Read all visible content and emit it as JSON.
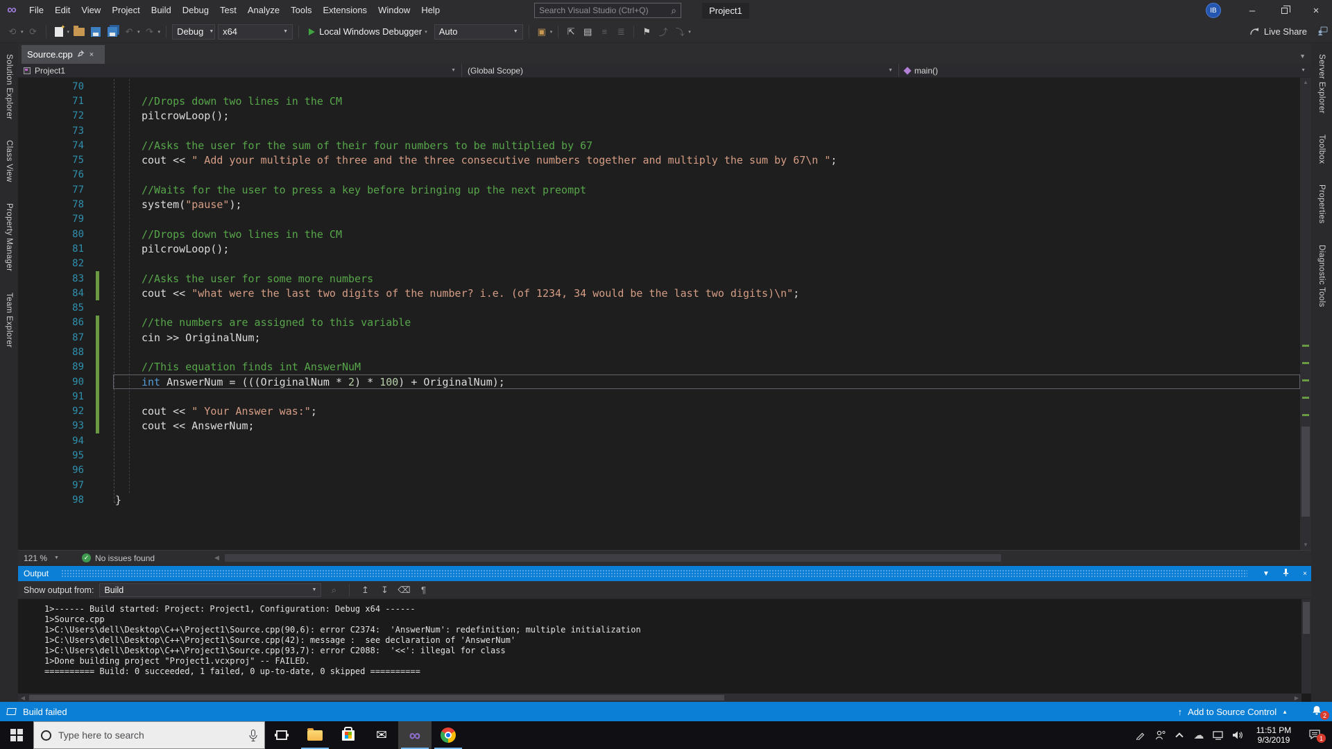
{
  "window": {
    "project": "Project1",
    "search_placeholder": "Search Visual Studio (Ctrl+Q)",
    "user_initials": "IB",
    "live_share": "Live Share"
  },
  "menu": {
    "items": [
      "File",
      "Edit",
      "View",
      "Project",
      "Build",
      "Debug",
      "Test",
      "Analyze",
      "Tools",
      "Extensions",
      "Window",
      "Help"
    ]
  },
  "toolbar": {
    "configuration": "Debug",
    "platform": "x64",
    "debugger": "Local Windows Debugger",
    "attach": "Auto"
  },
  "panels": {
    "left": [
      "Solution Explorer",
      "Class View",
      "Property Manager",
      "Team Explorer"
    ],
    "right": [
      "Server Explorer",
      "Toolbox",
      "Properties",
      "Diagnostic Tools"
    ]
  },
  "editor": {
    "tab": "Source.cpp",
    "breadcrumb": {
      "project": "Project1",
      "scope": "(Global Scope)",
      "method": "main()"
    },
    "zoom_level": "121 %",
    "health": "No issues found",
    "lines": [
      {
        "n": 70,
        "ind": 1,
        "segs": []
      },
      {
        "n": 71,
        "ind": 1,
        "segs": [
          {
            "c": "cm",
            "t": "//Drops down two lines in the CM"
          }
        ]
      },
      {
        "n": 72,
        "ind": 1,
        "segs": [
          {
            "c": "pl",
            "t": "pilcrowLoop();"
          }
        ]
      },
      {
        "n": 73,
        "ind": 1,
        "segs": []
      },
      {
        "n": 74,
        "ind": 1,
        "segs": [
          {
            "c": "cm",
            "t": "//Asks the user for the sum of their four numbers to be multiplied by 67"
          }
        ]
      },
      {
        "n": 75,
        "ind": 1,
        "segs": [
          {
            "c": "pl",
            "t": "cout << "
          },
          {
            "c": "st",
            "t": "\" Add your multiple of three and the three consecutive numbers together and multiply the sum by 67\\n \""
          },
          {
            "c": "pl",
            "t": ";"
          }
        ]
      },
      {
        "n": 76,
        "ind": 1,
        "segs": []
      },
      {
        "n": 77,
        "ind": 1,
        "segs": [
          {
            "c": "cm",
            "t": "//Waits for the user to press a key before bringing up the next preompt"
          }
        ]
      },
      {
        "n": 78,
        "ind": 1,
        "segs": [
          {
            "c": "pl",
            "t": "system("
          },
          {
            "c": "st",
            "t": "\"pause\""
          },
          {
            "c": "pl",
            "t": ");"
          }
        ]
      },
      {
        "n": 79,
        "ind": 1,
        "segs": []
      },
      {
        "n": 80,
        "ind": 1,
        "segs": [
          {
            "c": "cm",
            "t": "//Drops down two lines in the CM"
          }
        ]
      },
      {
        "n": 81,
        "ind": 1,
        "segs": [
          {
            "c": "pl",
            "t": "pilcrowLoop();"
          }
        ]
      },
      {
        "n": 82,
        "ind": 1,
        "segs": []
      },
      {
        "n": 83,
        "ind": 1,
        "chg": true,
        "segs": [
          {
            "c": "cm",
            "t": "//Asks the user for some more numbers"
          }
        ]
      },
      {
        "n": 84,
        "ind": 1,
        "chg": true,
        "segs": [
          {
            "c": "pl",
            "t": "cout << "
          },
          {
            "c": "st",
            "t": "\"what were the last two digits of the number? i.e. (of 1234, 34 would be the last two digits)\\n\""
          },
          {
            "c": "pl",
            "t": ";"
          }
        ]
      },
      {
        "n": 85,
        "ind": 1,
        "segs": []
      },
      {
        "n": 86,
        "ind": 1,
        "chg": true,
        "segs": [
          {
            "c": "cm",
            "t": "//the numbers are assigned to this variable"
          }
        ]
      },
      {
        "n": 87,
        "ind": 1,
        "chg": true,
        "segs": [
          {
            "c": "pl",
            "t": "cin >> OriginalNum;"
          }
        ]
      },
      {
        "n": 88,
        "ind": 1,
        "chg": true,
        "segs": []
      },
      {
        "n": 89,
        "ind": 1,
        "chg": true,
        "segs": [
          {
            "c": "cm",
            "t": "//This equation finds int AnswerNuM"
          }
        ]
      },
      {
        "n": 90,
        "ind": 1,
        "chg": true,
        "cur": true,
        "segs": [
          {
            "c": "kw",
            "t": "int"
          },
          {
            "c": "pl",
            "t": " AnswerNum = (((OriginalNum * "
          },
          {
            "c": "nm",
            "t": "2"
          },
          {
            "c": "pl",
            "t": ") * "
          },
          {
            "c": "nm",
            "t": "100"
          },
          {
            "c": "pl",
            "t": ") + OriginalNum);"
          }
        ]
      },
      {
        "n": 91,
        "ind": 1,
        "chg": true,
        "segs": []
      },
      {
        "n": 92,
        "ind": 1,
        "chg": true,
        "segs": [
          {
            "c": "pl",
            "t": "cout << "
          },
          {
            "c": "st",
            "t": "\" Your Answer was:\""
          },
          {
            "c": "pl",
            "t": ";"
          }
        ]
      },
      {
        "n": 93,
        "ind": 1,
        "chg": true,
        "segs": [
          {
            "c": "pl",
            "t": "cout << AnswerNum;"
          }
        ]
      },
      {
        "n": 94,
        "ind": 1,
        "segs": []
      },
      {
        "n": 95,
        "ind": 1,
        "segs": []
      },
      {
        "n": 96,
        "ind": 1,
        "segs": []
      },
      {
        "n": 97,
        "ind": 1,
        "segs": []
      },
      {
        "n": 98,
        "ind": 0,
        "segs": [
          {
            "c": "pl",
            "t": "}"
          }
        ]
      }
    ]
  },
  "output": {
    "title": "Output",
    "show_label": "Show output from:",
    "source": "Build",
    "lines": [
      "1>------ Build started: Project: Project1, Configuration: Debug x64 ------",
      "1>Source.cpp",
      "1>C:\\Users\\dell\\Desktop\\C++\\Project1\\Source.cpp(90,6): error C2374:  'AnswerNum': redefinition; multiple initialization",
      "1>C:\\Users\\dell\\Desktop\\C++\\Project1\\Source.cpp(42): message :  see declaration of 'AnswerNum'",
      "1>C:\\Users\\dell\\Desktop\\C++\\Project1\\Source.cpp(93,7): error C2088:  '<<': illegal for class",
      "1>Done building project \"Project1.vcxproj\" -- FAILED.",
      "========== Build: 0 succeeded, 1 failed, 0 up-to-date, 0 skipped =========="
    ]
  },
  "statusbar": {
    "build_status": "Build failed",
    "source_control": "Add to Source Control",
    "notification_count": "2"
  },
  "taskbar": {
    "search_placeholder": "Type here to search",
    "time": "11:51 PM",
    "date": "9/3/2019",
    "action_center_badge": "1"
  }
}
